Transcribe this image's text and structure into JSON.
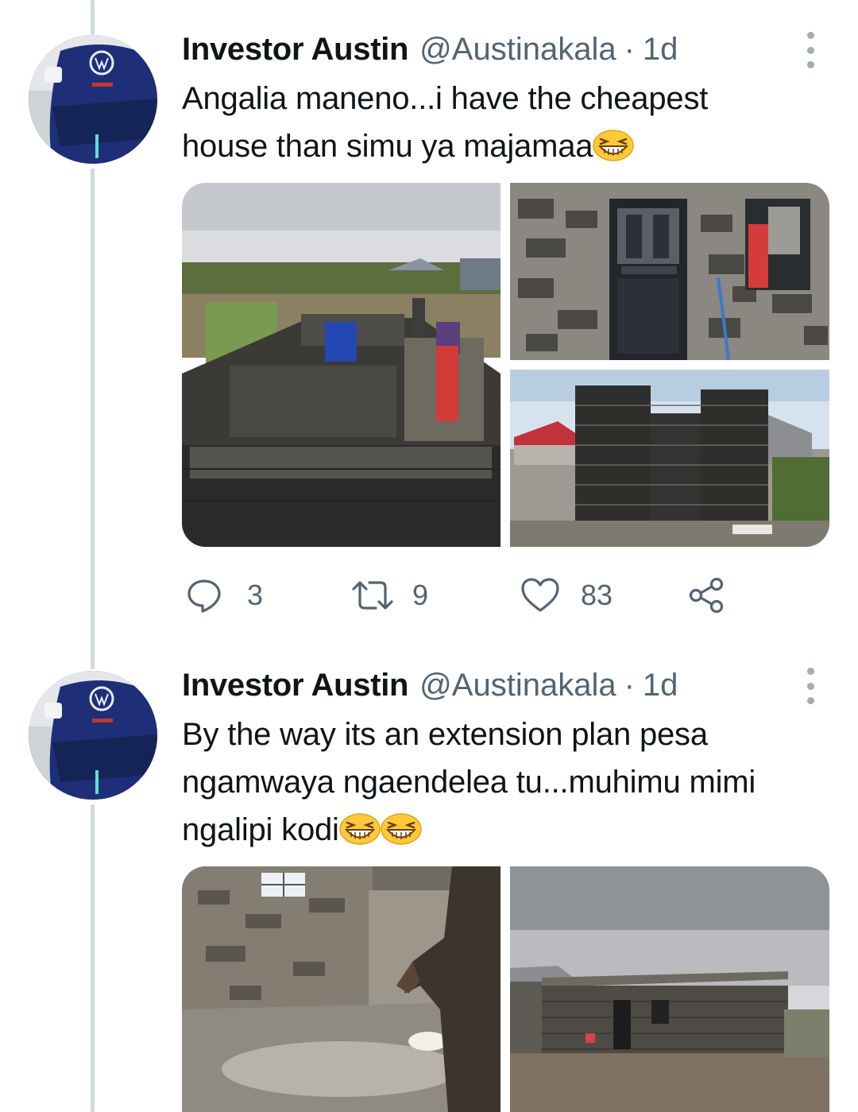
{
  "tweets": [
    {
      "name": "Investor Austin",
      "handle": "@Austinakala",
      "separator": "·",
      "time": "1d",
      "text_line1": "Angalia maneno...i have the cheapest",
      "text_line2": "house than simu ya majamaa",
      "emojis": [
        "grinning-squinting-face"
      ],
      "media": [
        {
          "name": "photo-foundation-walls",
          "description_icon": "photo"
        },
        {
          "name": "photo-door-window",
          "description_icon": "photo"
        },
        {
          "name": "photo-block-wall",
          "description_icon": "photo"
        }
      ],
      "actions": {
        "replies": "3",
        "retweets": "9",
        "likes": "83"
      }
    },
    {
      "name": "Investor Austin",
      "handle": "@Austinakala",
      "separator": "·",
      "time": "1d",
      "text_line1": "By the way its an extension plan pesa",
      "text_line2": "ngamwaya ngaendelea tu...muhimu mimi",
      "text_line3": "ngalipi kodi",
      "emojis": [
        "grinning-squinting-face",
        "grinning-squinting-face"
      ],
      "media": [
        {
          "name": "photo-interior-floor",
          "description_icon": "photo"
        },
        {
          "name": "photo-house-exterior",
          "description_icon": "photo"
        }
      ]
    }
  ],
  "icons": {
    "reply": "reply-icon",
    "retweet": "retweet-icon",
    "like": "heart-icon",
    "share": "share-icon",
    "more": "more-vertical-icon"
  },
  "colors": {
    "text_primary": "#0f1419",
    "text_secondary": "#536471",
    "thread_line": "#cfd9de",
    "emoji_face": "#ffc93a"
  }
}
